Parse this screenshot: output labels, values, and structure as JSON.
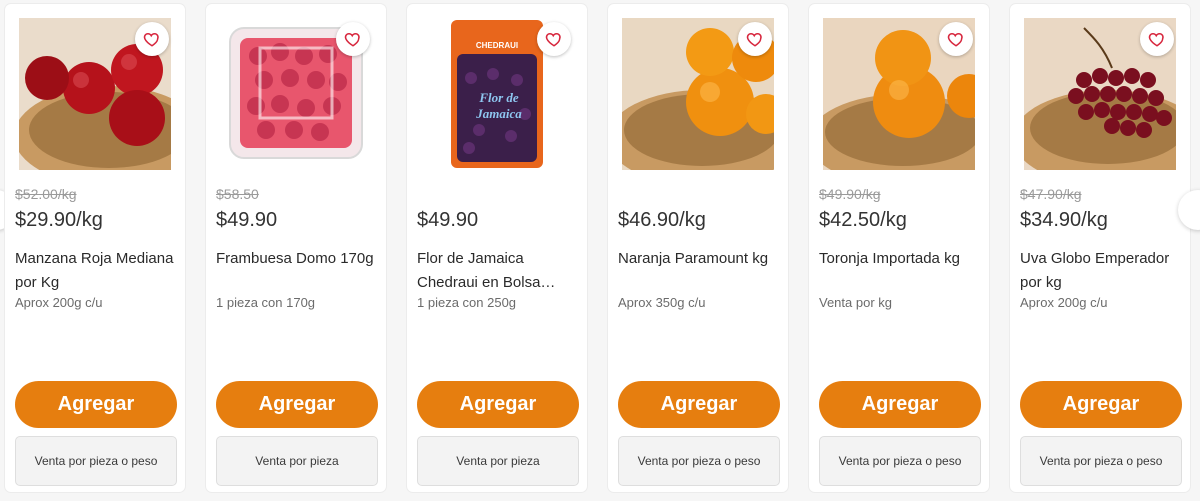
{
  "colors": {
    "accent": "#e67e0f",
    "heart": "#d7263d"
  },
  "products": [
    {
      "image": "red-apples-in-basket",
      "old_price": "$52.00/kg",
      "price": "$29.90/kg",
      "name": "Manzana Roja Mediana por Kg",
      "sub": "Aprox 200g c/u",
      "add_label": "Agregar",
      "mode_label": "Venta por pieza o peso"
    },
    {
      "image": "raspberries-clamshell",
      "old_price": "$58.50",
      "price": "$49.90",
      "name": "Frambuesa Domo 170g",
      "sub": "1 pieza con 170g",
      "add_label": "Agregar",
      "mode_label": "Venta por pieza"
    },
    {
      "image": "jamaica-flower-bag",
      "old_price": "",
      "price": "$49.90",
      "name": "Flor de Jamaica Chedraui en Bolsa…",
      "sub": "1 pieza con 250g",
      "add_label": "Agregar",
      "mode_label": "Venta por pieza"
    },
    {
      "image": "oranges-in-basket",
      "old_price": "",
      "price": "$46.90/kg",
      "name": "Naranja Paramount kg",
      "sub": "Aprox 350g c/u",
      "add_label": "Agregar",
      "mode_label": "Venta por pieza o peso"
    },
    {
      "image": "grapefruit-in-basket",
      "old_price": "$49.90/kg",
      "price": "$42.50/kg",
      "name": "Toronja Importada kg",
      "sub": "Venta por kg",
      "add_label": "Agregar",
      "mode_label": "Venta por pieza o peso"
    },
    {
      "image": "red-grapes-in-basket",
      "old_price": "$47.90/kg",
      "price": "$34.90/kg",
      "name": "Uva Globo Emperador por kg",
      "sub": "Aprox 200g c/u",
      "add_label": "Agregar",
      "mode_label": "Venta por pieza o peso"
    }
  ],
  "bag_text": {
    "brand": "CHEDRAUI",
    "line1": "Flor de",
    "line2": "Jamaica"
  }
}
